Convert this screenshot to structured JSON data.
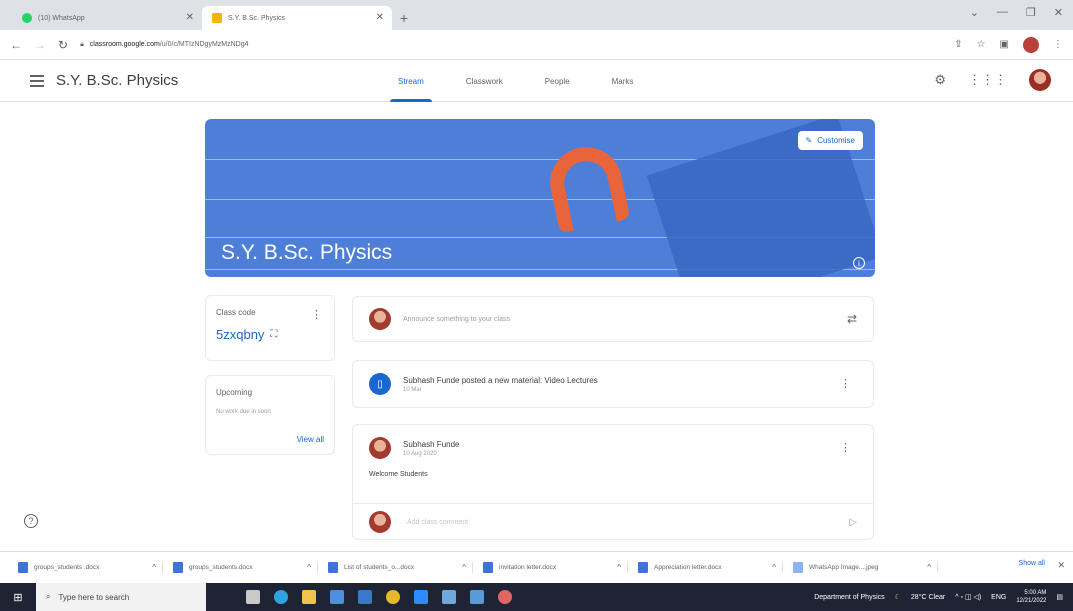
{
  "browser": {
    "tabs": [
      {
        "label": "(10) WhatsApp",
        "color": "#25d366"
      },
      {
        "label": "S.Y. B.Sc. Physics",
        "color": "#f4b400"
      }
    ],
    "url_host": "classroom.google.com",
    "url_path": "/u/0/c/MTIzNDgyMzMzNDg4"
  },
  "header": {
    "class_name": "S.Y. B.Sc. Physics",
    "tabs": [
      "Stream",
      "Classwork",
      "People",
      "Marks"
    ],
    "active_tab": "Stream"
  },
  "banner": {
    "title": "S.Y. B.Sc. Physics",
    "customise_label": "Customise",
    "color": "#4d7fd8"
  },
  "class_code": {
    "label": "Class code",
    "code": "5zxqbny"
  },
  "upcoming": {
    "title": "Upcoming",
    "status": "No work due in soon",
    "view_all": "View all"
  },
  "announce": {
    "placeholder": "Announce something to your class"
  },
  "posts": [
    {
      "title": "Subhash Funde posted a new material: Video Lectures",
      "date": "10 Mar"
    },
    {
      "author": "Subhash Funde",
      "date": "10 Aug 2020",
      "body": "Welcome Students",
      "comment_placeholder": "Add class comment"
    }
  ],
  "downloads": [
    "groups_students .docx",
    "groups_students.docx",
    "List of students_o...docx",
    "invitation letter.docx",
    "Appreciation letter.docx",
    "WhatsApp Image....jpeg"
  ],
  "downloads_show_all": "Show all",
  "taskbar": {
    "search_placeholder": "Type here to search",
    "tray_text": "Department of Physics",
    "weather": "28°C Clear",
    "lang": "ENG",
    "time": "5:00 AM",
    "date": "12/21/2022"
  }
}
